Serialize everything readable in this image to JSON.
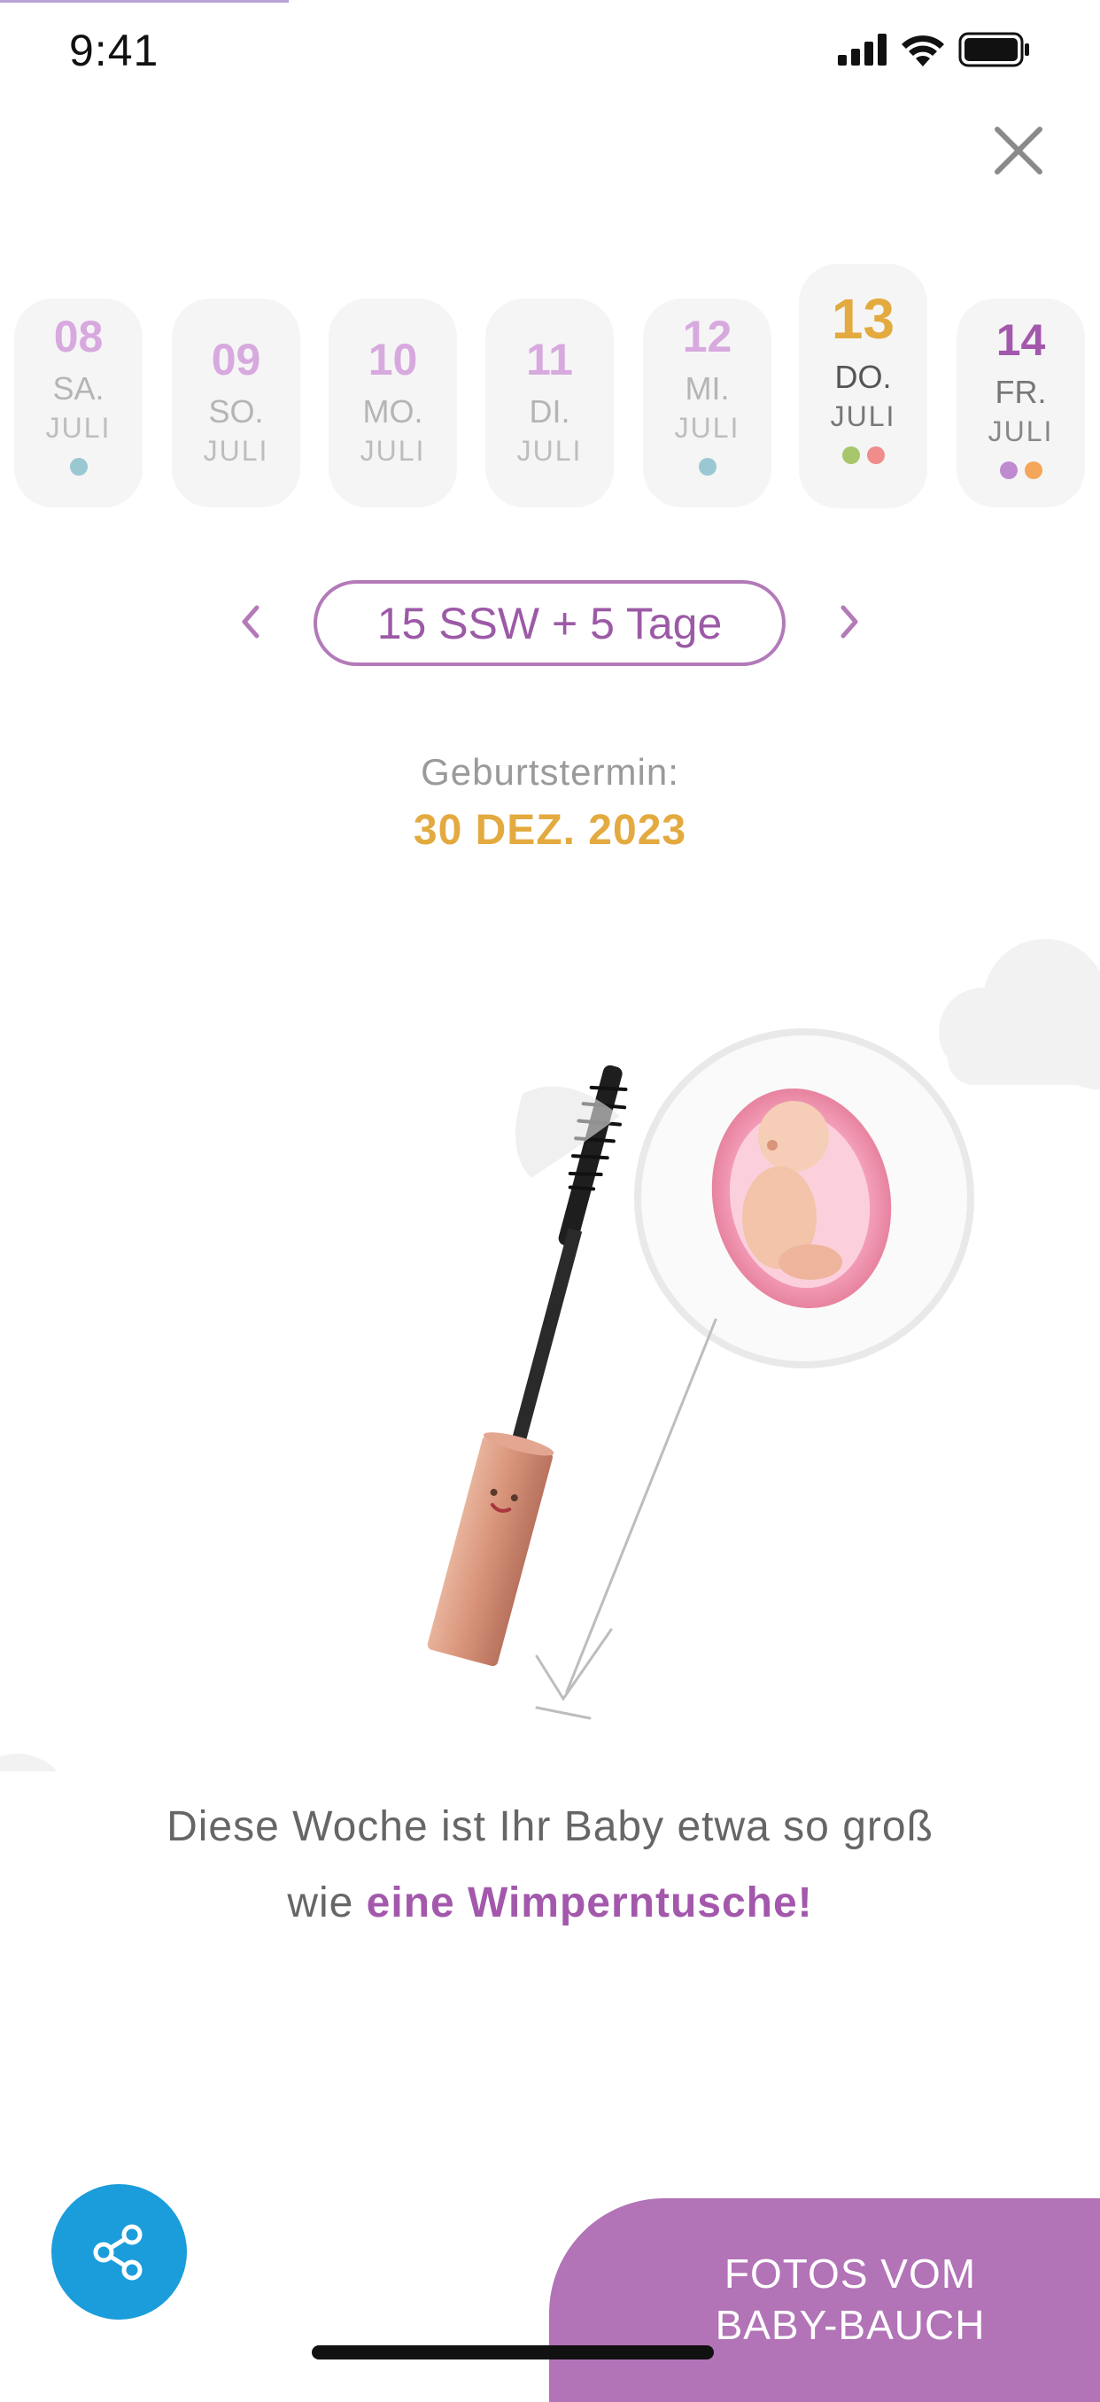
{
  "status_bar": {
    "time": "9:41"
  },
  "days": [
    {
      "num": "08",
      "weekday": "SA.",
      "month": "JULI",
      "dots": [
        "#9ac8d2"
      ]
    },
    {
      "num": "09",
      "weekday": "SO.",
      "month": "JULI",
      "dots": []
    },
    {
      "num": "10",
      "weekday": "MO.",
      "month": "JULI",
      "dots": []
    },
    {
      "num": "11",
      "weekday": "DI.",
      "month": "JULI",
      "dots": []
    },
    {
      "num": "12",
      "weekday": "MI.",
      "month": "JULI",
      "dots": [
        "#9ac8d2"
      ]
    },
    {
      "num": "13",
      "weekday": "DO.",
      "month": "JULI",
      "dots": [
        "#a8c66c",
        "#f08c8c"
      ],
      "active": true
    },
    {
      "num": "14",
      "weekday": "FR.",
      "month": "JULI",
      "dots": [
        "#c08ad0",
        "#f5a65b"
      ]
    }
  ],
  "week": {
    "label": "15 SSW + 5 Tage"
  },
  "due": {
    "label": "Geburtstermin:",
    "date": "30 DEZ. 2023"
  },
  "caption": {
    "line1": "Diese Woche ist Ihr Baby etwa so groß",
    "line2_prefix": "wie ",
    "line2_highlight": "eine Wimperntusche!"
  },
  "photos_button": {
    "line1": "FOTOS VOM",
    "line2": "BABY-BAUCH"
  },
  "colors": {
    "accent_purple": "#b273b7",
    "due_date": "#e3aa3f",
    "share_blue": "#1b9ddb"
  },
  "icons": [
    "signal-icon",
    "wifi-icon",
    "battery-icon",
    "close-icon",
    "chevron-left-icon",
    "chevron-right-icon",
    "share-icon"
  ]
}
